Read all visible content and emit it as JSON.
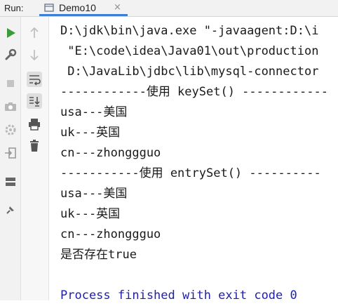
{
  "header": {
    "run_label": "Run:",
    "tab_title": "Demo10",
    "tab_close": "×"
  },
  "toolbar_left": [
    "run-icon",
    "wrench-icon",
    "stop-icon",
    "camera-icon",
    "gear-icon",
    "login-icon",
    "layout-icon",
    "pin-icon"
  ],
  "toolbar_right": [
    "arrow-up-icon",
    "arrow-down-icon",
    "soft-wrap-icon",
    "scroll-to-end-icon",
    "print-icon",
    "trash-icon"
  ],
  "console": {
    "lines": [
      "D:\\jdk\\bin\\java.exe \"-javaagent:D:\\i",
      " \"E:\\code\\idea\\Java01\\out\\production",
      " D:\\JavaLib\\jdbc\\lib\\mysql-connector",
      "------------使用 keySet() ------------",
      "usa---美国",
      "uk---英国",
      "cn---zhonggguo",
      "-----------使用 entrySet() ----------",
      "usa---美国",
      "uk---英国",
      "cn---zhonggguo",
      "是否存在true",
      "",
      "Process finished with exit code 0"
    ]
  },
  "colors": {
    "run_green": "#3b9b3b",
    "tab_underline": "#3d7fd6",
    "finish_text": "#1f1fa8"
  }
}
